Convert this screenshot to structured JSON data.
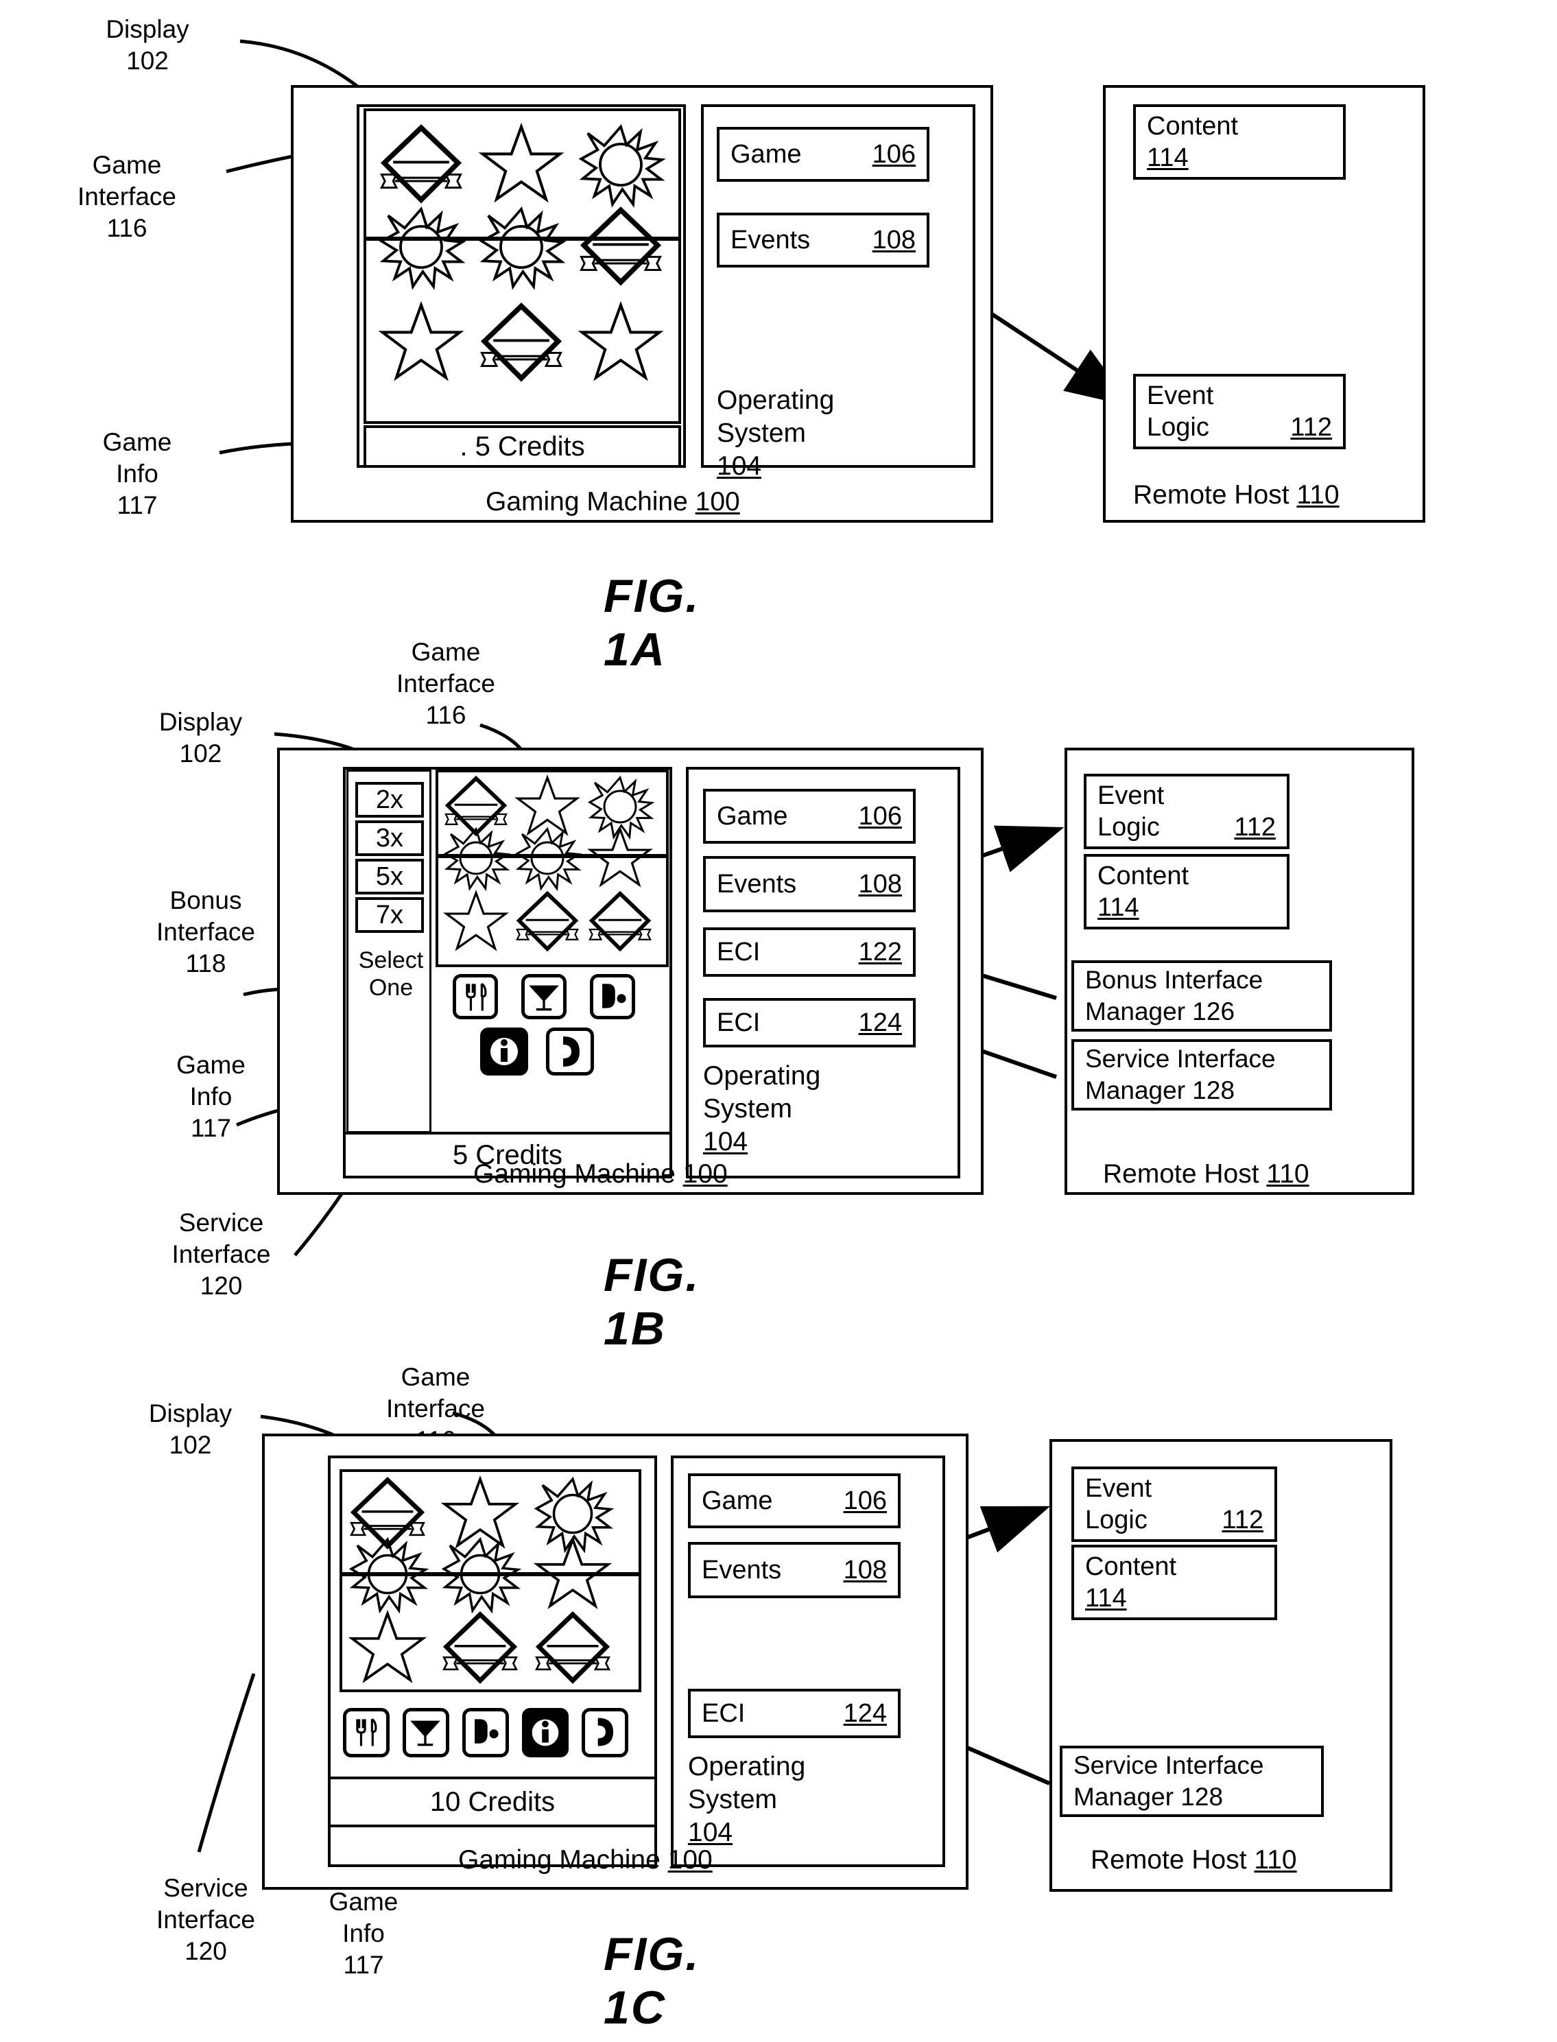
{
  "figures": [
    {
      "id": "fig1a",
      "name": "FIG. 1A",
      "callouts": {
        "display": "Display\n102",
        "game_interface": "Game\nInterface\n116",
        "game_info": "Game\nInfo\n117"
      },
      "gaming_machine_label": "Gaming Machine 100",
      "gaming_machine_num": "100",
      "os_label": "Operating\nSystem 104",
      "os_num": "104",
      "credits": ". 5 Credits",
      "modules": [
        {
          "label": "Game",
          "num": "106"
        },
        {
          "label": "Events",
          "num": "108"
        }
      ],
      "remote_host_label": "Remote Host 110",
      "remote_host_num": "110",
      "host_modules": [
        {
          "line1": "Content",
          "line2": "114",
          "num": "114"
        },
        {
          "line1": "Event",
          "line2": "Logic",
          "num": "112"
        }
      ],
      "reels": [
        [
          "diamond",
          "star",
          "sun"
        ],
        [
          "sun",
          "sun",
          "diamond"
        ],
        [
          "star",
          "diamond",
          "star"
        ]
      ]
    },
    {
      "id": "fig1b",
      "name": "FIG. 1B",
      "callouts": {
        "display": "Display\n102",
        "game_interface": "Game\nInterface\n116",
        "bonus_interface": "Bonus\nInterface\n118",
        "game_info": "Game\nInfo\n117",
        "service_interface": "Service\nInterface\n120"
      },
      "gaming_machine_label": "Gaming Machine 100",
      "gaming_machine_num": "100",
      "os_label": "Operating\nSystem 104",
      "os_num": "104",
      "credits": "5 Credits",
      "multipliers": [
        "2x",
        "3x",
        "5x",
        "7x"
      ],
      "select_one": "Select\nOne",
      "service_icons": [
        "fork-knife-icon",
        "martini-icon",
        "room-service-icon",
        "info-icon",
        "phone-icon"
      ],
      "service_icons_filled": [
        false,
        false,
        true,
        true,
        true
      ],
      "modules": [
        {
          "label": "Game",
          "num": "106"
        },
        {
          "label": "Events",
          "num": "108"
        },
        {
          "label": "ECI",
          "num": "122"
        },
        {
          "label": "ECI",
          "num": "124"
        }
      ],
      "remote_host_label": "Remote Host 110",
      "remote_host_num": "110",
      "host_modules": [
        {
          "line1": "Event",
          "line2": "Logic",
          "num": "112"
        },
        {
          "line1": "Content",
          "line2": "114",
          "num": "114"
        },
        {
          "line1": "Bonus Interface",
          "line2": "Manager 126",
          "num": "126"
        },
        {
          "line1": "Service Interface",
          "line2": "Manager 128",
          "num": "128"
        }
      ],
      "reels": [
        [
          "diamond",
          "star",
          "sun"
        ],
        [
          "sun",
          "sun",
          "star"
        ],
        [
          "star",
          "diamond",
          "diamond"
        ]
      ]
    },
    {
      "id": "fig1c",
      "name": "FIG. 1C",
      "callouts": {
        "display": "Display\n102",
        "game_interface": "Game\nInterface\n116",
        "service_interface": "Service\nInterface\n120",
        "game_info": "Game\nInfo\n117"
      },
      "gaming_machine_label": "Gaming Machine 100",
      "gaming_machine_num": "100",
      "os_label": "Operating\nSystem 104",
      "os_num": "104",
      "credits": "10 Credits",
      "service_icons": [
        "fork-knife-icon",
        "martini-icon",
        "room-service-icon",
        "info-icon",
        "phone-icon"
      ],
      "service_icons_filled": [
        false,
        false,
        false,
        true,
        false
      ],
      "modules": [
        {
          "label": "Game",
          "num": "106"
        },
        {
          "label": "Events",
          "num": "108"
        },
        {
          "label": "ECI",
          "num": "124"
        }
      ],
      "remote_host_label": "Remote Host 110",
      "remote_host_num": "110",
      "host_modules": [
        {
          "line1": "Event",
          "line2": "Logic",
          "num": "112"
        },
        {
          "line1": "Content",
          "line2": "114",
          "num": "114"
        },
        {
          "line1": "Service Interface",
          "line2": "Manager 128",
          "num": "128"
        }
      ],
      "reels": [
        [
          "diamond",
          "star",
          "sun"
        ],
        [
          "sun",
          "sun",
          "star"
        ],
        [
          "star",
          "diamond",
          "diamond"
        ]
      ]
    }
  ]
}
